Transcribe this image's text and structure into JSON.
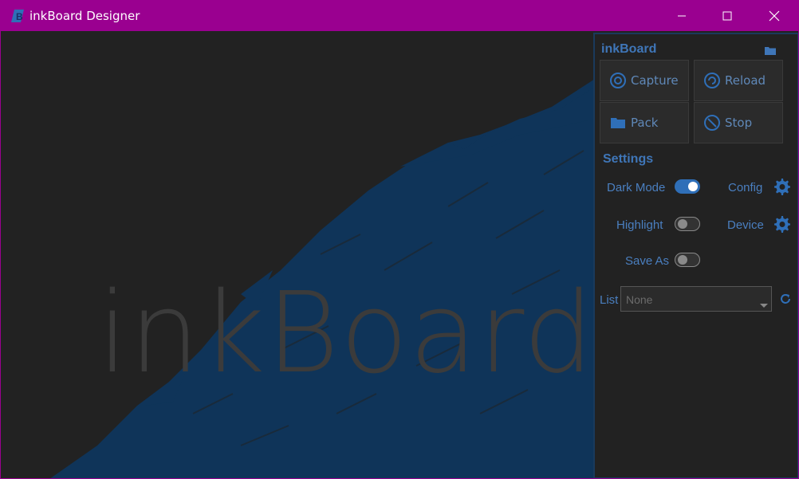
{
  "window": {
    "title": "inkBoard Designer"
  },
  "canvas": {
    "wordmark": "inkBoard"
  },
  "panel": {
    "title": "inkBoard",
    "buttons": {
      "capture": "Capture",
      "reload": "Reload",
      "pack": "Pack",
      "stop": "Stop"
    },
    "settings": {
      "heading": "Settings",
      "dark_mode": {
        "label": "Dark Mode",
        "on": true
      },
      "highlight": {
        "label": "Highlight",
        "on": false
      },
      "save_as": {
        "label": "Save As",
        "on": false
      },
      "config_label": "Config",
      "device_label": "Device"
    },
    "list": {
      "label": "List",
      "selected": "None"
    }
  },
  "colors": {
    "titlebar": "#9a0090",
    "accent": "#3f76b8",
    "brush": "#0f3459",
    "background": "#222222"
  },
  "icons": [
    "app-icon",
    "minimize-icon",
    "maximize-icon",
    "close-icon",
    "folder-icon",
    "aperture-icon",
    "reload-icon",
    "pack-folder-icon",
    "stop-icon",
    "gear-icon",
    "refresh-icon"
  ]
}
